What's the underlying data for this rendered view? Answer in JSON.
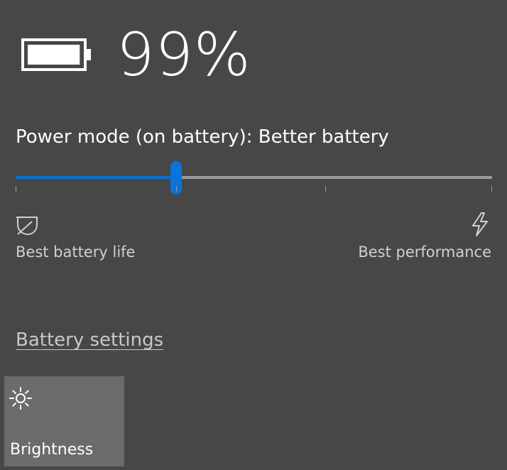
{
  "battery": {
    "icon": "battery-full-icon",
    "percent_label": "99%",
    "level_fraction": 0.99
  },
  "power_mode": {
    "label": "Power mode (on battery): Better battery",
    "slider_value_fraction": 0.3375,
    "tick_fractions": [
      0,
      0.3375,
      0.65,
      1
    ],
    "min_label": "Best battery life",
    "max_label": "Best performance",
    "min_icon": "leaf-icon",
    "max_icon": "lightning-bolt-icon"
  },
  "links": {
    "battery_settings": "Battery settings"
  },
  "quick_actions": [
    {
      "label": "Brightness",
      "icon": "sun-icon"
    }
  ],
  "colors": {
    "background": "#474747",
    "accent": "#0a74da",
    "track": "#9b9b9b",
    "tile": "#6b6b6b"
  }
}
